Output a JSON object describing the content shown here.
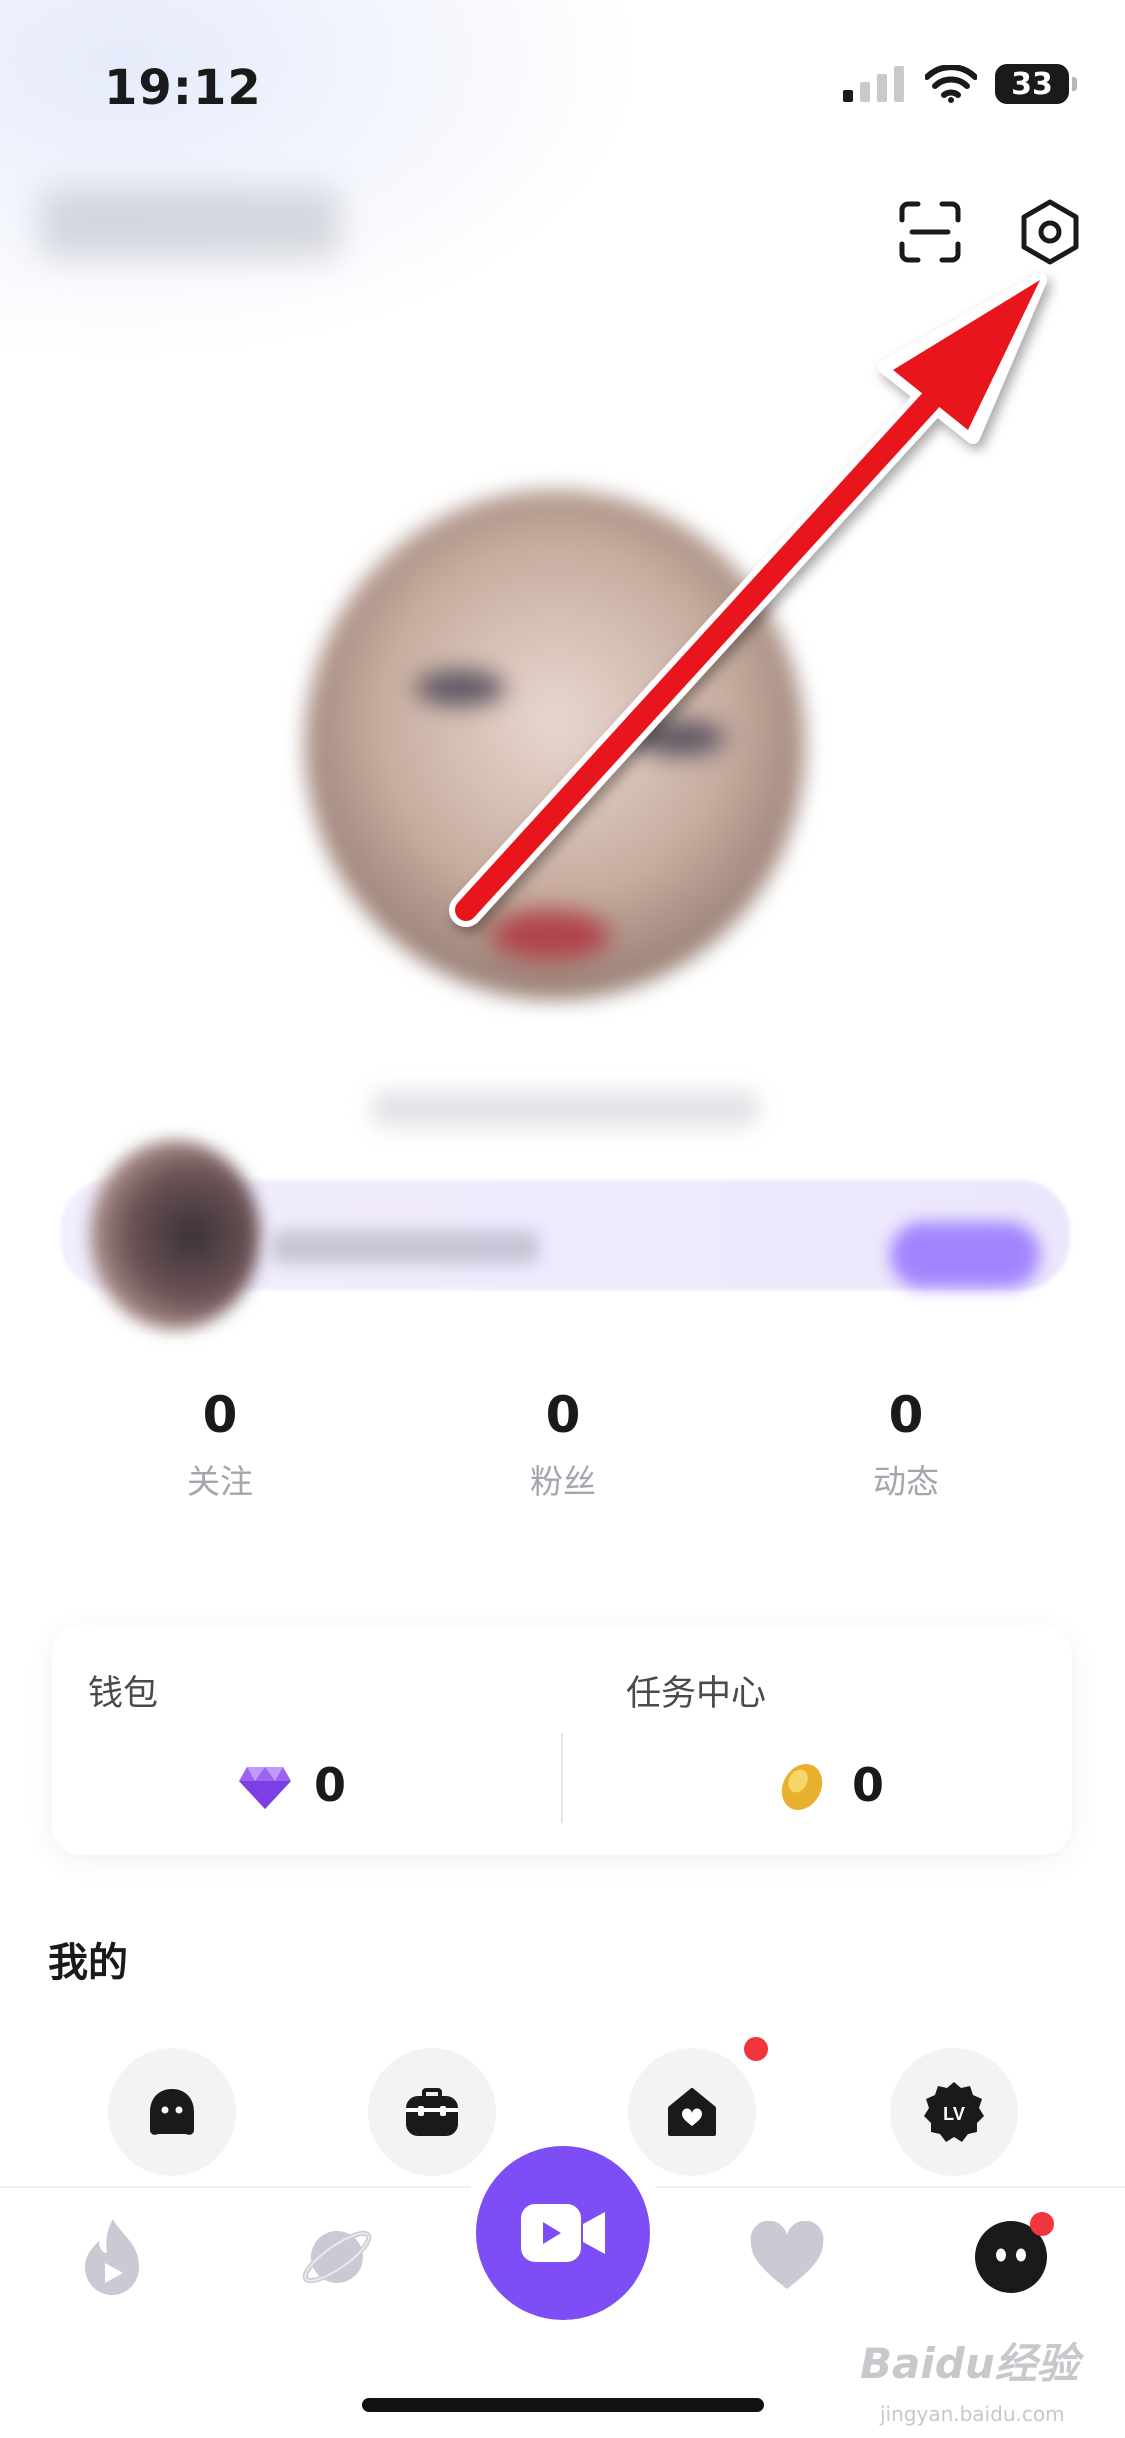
{
  "status_bar": {
    "time": "19:12",
    "battery": "33",
    "icons": [
      "cellular-signal-icon",
      "wifi-icon",
      "battery-icon"
    ]
  },
  "header": {
    "icons": [
      "scan-icon",
      "settings-icon"
    ]
  },
  "stats": [
    {
      "value": "0",
      "label": "关注"
    },
    {
      "value": "0",
      "label": "粉丝"
    },
    {
      "value": "0",
      "label": "动态"
    }
  ],
  "wallet": {
    "left_label": "钱包",
    "left_value": "0",
    "left_icon": "diamond-icon",
    "right_label": "任务中心",
    "right_value": "0",
    "right_icon": "bean-coin-icon"
  },
  "my_section": {
    "title": "我的",
    "items": [
      {
        "icon": "ghost-icon"
      },
      {
        "icon": "backpack-icon"
      },
      {
        "icon": "heart-house-icon",
        "badge": true
      },
      {
        "icon": "level-badge-icon",
        "text": "LV"
      }
    ]
  },
  "tabbar": {
    "items": [
      "flame-play-icon",
      "planet-icon",
      "video-camera-icon",
      "heart-icon",
      "profile-ghost-icon"
    ]
  },
  "watermark": {
    "brand": "Baidu经验",
    "sub": "jingyan.baidu.com"
  },
  "colors": {
    "accent": "#7d4df5",
    "badge": "#f2343c",
    "muted_text": "#a3a6ad",
    "arrow": "#e8141b"
  }
}
